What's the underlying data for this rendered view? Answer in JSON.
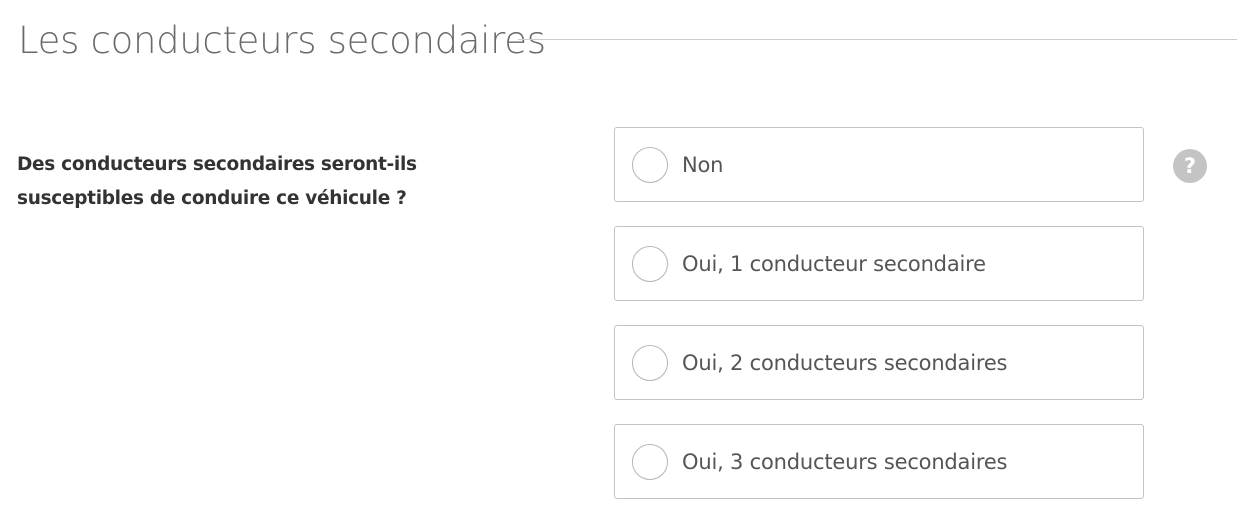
{
  "section": {
    "title": "Les conducteurs secondaires"
  },
  "question": {
    "text": "Des conducteurs secondaires seront-ils susceptibles de conduire ce véhicule ?"
  },
  "options": [
    {
      "label": "Non",
      "selected": false
    },
    {
      "label": "Oui, 1 conducteur secondaire",
      "selected": false
    },
    {
      "label": "Oui, 2 conducteurs secondaires",
      "selected": false
    },
    {
      "label": "Oui, 3 conducteurs secondaires",
      "selected": false
    }
  ],
  "help": {
    "icon": "question-mark-icon",
    "glyph": "?",
    "color": "#c4c4c4"
  }
}
